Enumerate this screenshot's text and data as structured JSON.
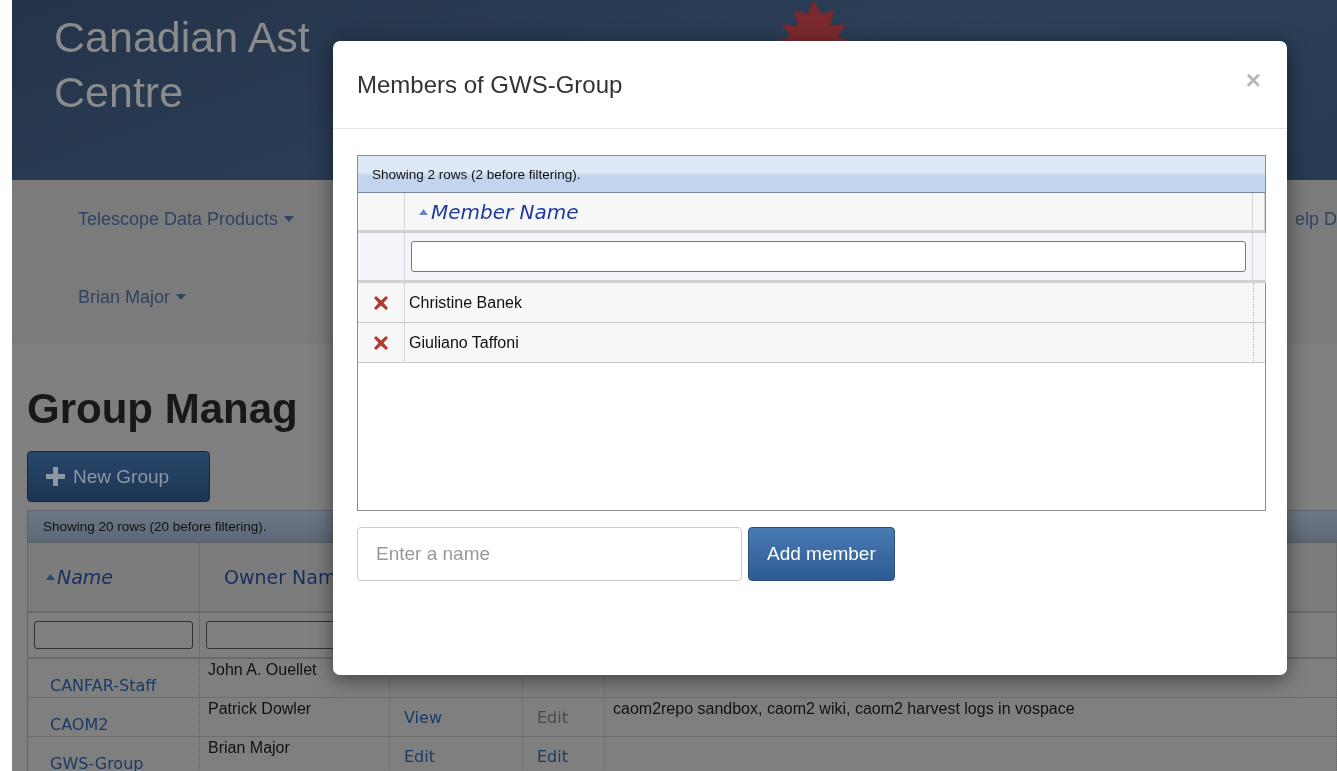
{
  "header": {
    "title_lines": [
      "Canadian Ast",
      "Centre"
    ]
  },
  "nav": {
    "items": [
      {
        "label": "Telescope Data Products",
        "dropdown": true
      },
      {
        "label": "elp D",
        "dropdown": false
      }
    ],
    "user_menu": {
      "label": "Brian Major",
      "dropdown": true
    }
  },
  "page": {
    "heading": "Group Manag",
    "new_group_button": "New Group",
    "table": {
      "info": "Showing 20 rows (20 before filtering).",
      "columns": [
        {
          "label": "Name",
          "sorted": true
        },
        {
          "label": "Owner Nam",
          "sorted": false
        }
      ],
      "rows": [
        {
          "name": "CANFAR-Staff",
          "owner": "John A. Ouellet"
        },
        {
          "name": "CAOM2",
          "owner": "Patrick Dowler",
          "view": {
            "label": "View",
            "disabled": false
          },
          "edit": {
            "label": "Edit",
            "disabled": true
          },
          "description": "caom2repo sandbox, caom2 wiki, caom2 harvest logs in vospace"
        },
        {
          "name": "GWS-Group",
          "owner": "Brian Major",
          "view": {
            "label": "Edit",
            "disabled": false
          },
          "edit": {
            "label": "Edit",
            "disabled": false
          }
        }
      ]
    }
  },
  "modal": {
    "title": "Members of GWS-Group",
    "close": "×",
    "grid": {
      "info": "Showing 2 rows (2 before filtering).",
      "column": {
        "label": "Member Name",
        "sorted": true
      },
      "rows": [
        {
          "name": "Christine Banek"
        },
        {
          "name": "Giuliano Taffoni"
        }
      ]
    },
    "add": {
      "placeholder": "Enter a name",
      "button": "Add member"
    }
  }
}
